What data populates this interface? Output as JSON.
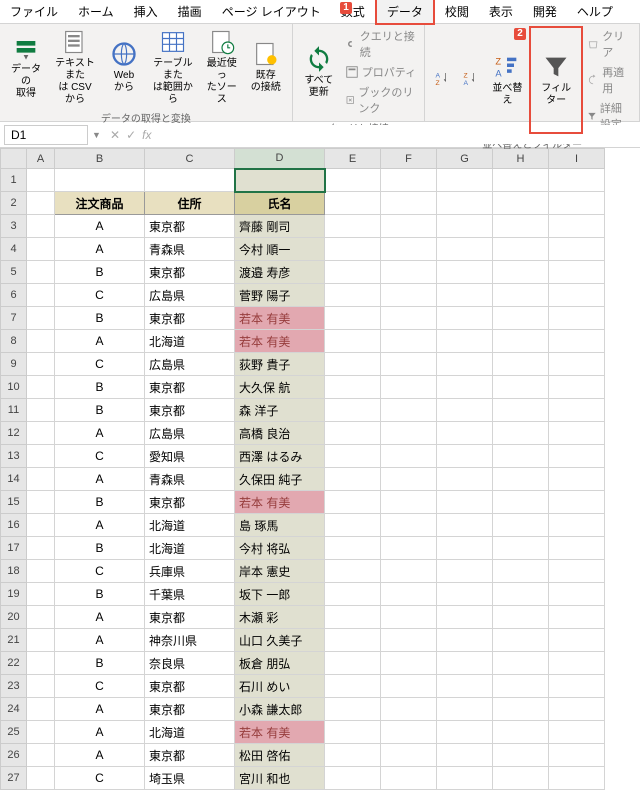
{
  "menubar": [
    "ファイル",
    "ホーム",
    "挿入",
    "描画",
    "ページ レイアウト",
    "数式",
    "データ",
    "校閲",
    "表示",
    "開発",
    "ヘルプ"
  ],
  "menubar_active": 6,
  "callouts": {
    "c1": "1",
    "c2": "2"
  },
  "ribbon": {
    "group1": {
      "label": "データの取得と変換",
      "btns": [
        {
          "id": "get-data",
          "label": "データの\n取得"
        },
        {
          "id": "from-csv",
          "label": "テキストまた\nは CSV から"
        },
        {
          "id": "from-web",
          "label": "Web\nから"
        },
        {
          "id": "from-table",
          "label": "テーブルまた\nは範囲から"
        },
        {
          "id": "recent",
          "label": "最近使っ\nたソース"
        },
        {
          "id": "existing",
          "label": "既存\nの接続"
        }
      ]
    },
    "group2": {
      "label": "クエリと接続",
      "refresh": "すべて\n更新",
      "small": [
        "クエリと接続",
        "プロパティ",
        "ブックのリンク"
      ]
    },
    "group3": {
      "label": "並べ替えとフィルター",
      "sort": "並べ替え",
      "filter": "フィルター",
      "small": [
        "クリア",
        "再適用",
        "詳細設定"
      ]
    }
  },
  "name_box": "D1",
  "fx_label": "fx",
  "columns": [
    "A",
    "B",
    "C",
    "D",
    "E",
    "F",
    "G",
    "H",
    "I"
  ],
  "selected_col": 3,
  "headers": {
    "b": "注文商品",
    "c": "住所",
    "d": "氏名"
  },
  "rows": [
    {
      "n": 1
    },
    {
      "n": 2,
      "header": true
    },
    {
      "n": 3,
      "b": "A",
      "c": "東京都",
      "d": "齊藤 剛司"
    },
    {
      "n": 4,
      "b": "A",
      "c": "青森県",
      "d": "今村 順一"
    },
    {
      "n": 5,
      "b": "B",
      "c": "東京都",
      "d": "渡邉 寿彦"
    },
    {
      "n": 6,
      "b": "C",
      "c": "広島県",
      "d": "菅野 陽子"
    },
    {
      "n": 7,
      "b": "B",
      "c": "東京都",
      "d": "若本 有美",
      "dup": true
    },
    {
      "n": 8,
      "b": "A",
      "c": "北海道",
      "d": "若本 有美",
      "dup": true
    },
    {
      "n": 9,
      "b": "C",
      "c": "広島県",
      "d": "荻野 貴子"
    },
    {
      "n": 10,
      "b": "B",
      "c": "東京都",
      "d": "大久保 航"
    },
    {
      "n": 11,
      "b": "B",
      "c": "東京都",
      "d": "森 洋子"
    },
    {
      "n": 12,
      "b": "A",
      "c": "広島県",
      "d": "高橋 良治"
    },
    {
      "n": 13,
      "b": "C",
      "c": "愛知県",
      "d": "西澤 はるみ"
    },
    {
      "n": 14,
      "b": "A",
      "c": "青森県",
      "d": "久保田 純子"
    },
    {
      "n": 15,
      "b": "B",
      "c": "東京都",
      "d": "若本 有美",
      "dup": true
    },
    {
      "n": 16,
      "b": "A",
      "c": "北海道",
      "d": "島 琢馬"
    },
    {
      "n": 17,
      "b": "B",
      "c": "北海道",
      "d": "今村 将弘"
    },
    {
      "n": 18,
      "b": "C",
      "c": "兵庫県",
      "d": "岸本 憲史"
    },
    {
      "n": 19,
      "b": "B",
      "c": "千葉県",
      "d": "坂下 一郎"
    },
    {
      "n": 20,
      "b": "A",
      "c": "東京都",
      "d": "木瀬 彩"
    },
    {
      "n": 21,
      "b": "A",
      "c": "神奈川県",
      "d": "山口 久美子"
    },
    {
      "n": 22,
      "b": "B",
      "c": "奈良県",
      "d": "板倉 朋弘"
    },
    {
      "n": 23,
      "b": "C",
      "c": "東京都",
      "d": "石川 めい"
    },
    {
      "n": 24,
      "b": "A",
      "c": "東京都",
      "d": "小森 謙太郎"
    },
    {
      "n": 25,
      "b": "A",
      "c": "北海道",
      "d": "若本 有美",
      "dup": true
    },
    {
      "n": 26,
      "b": "A",
      "c": "東京都",
      "d": "松田 啓佑"
    },
    {
      "n": 27,
      "b": "C",
      "c": "埼玉県",
      "d": "宮川 和也"
    }
  ]
}
